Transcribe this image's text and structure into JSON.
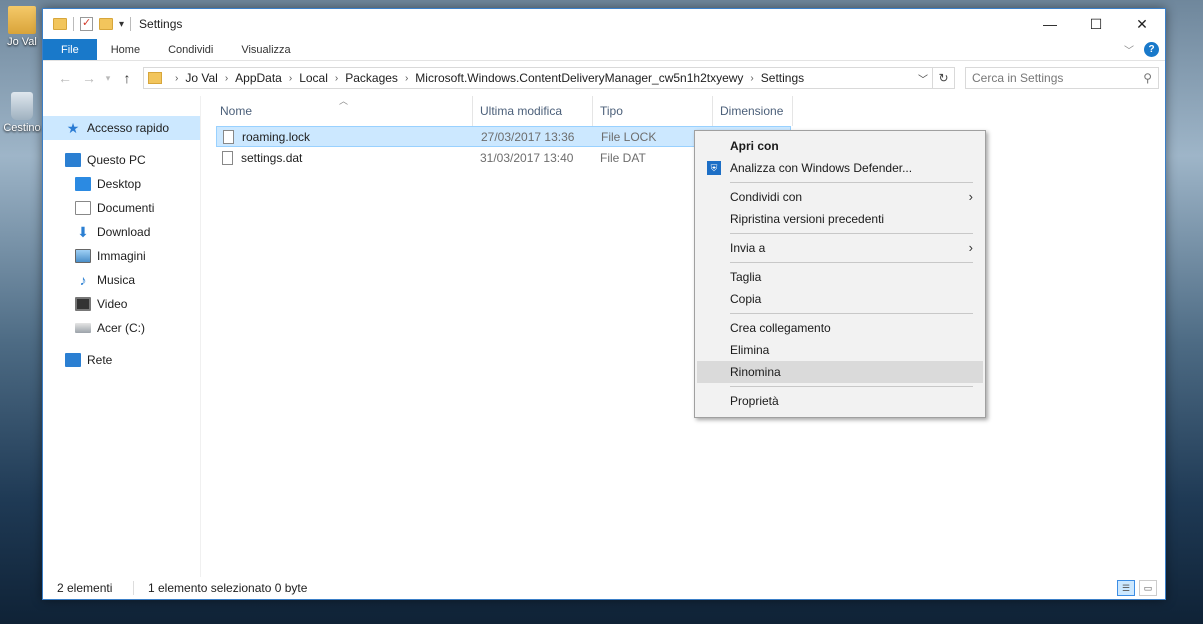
{
  "desktop": {
    "user_label": "Jo Val",
    "bin_label": "Cestino"
  },
  "window": {
    "title": "Settings",
    "controls": {
      "minimize": "—",
      "maximize": "☐",
      "close": "✕"
    }
  },
  "ribbon": {
    "tabs": [
      "File",
      "Home",
      "Condividi",
      "Visualizza"
    ]
  },
  "address": {
    "path": [
      "Jo Val",
      "AppData",
      "Local",
      "Packages",
      "Microsoft.Windows.ContentDeliveryManager_cw5n1h2txyewy",
      "Settings"
    ]
  },
  "search": {
    "placeholder": "Cerca in Settings"
  },
  "sidebar": {
    "items": [
      {
        "label": "Accesso rapido"
      },
      {
        "label": "Questo PC"
      },
      {
        "label": "Desktop"
      },
      {
        "label": "Documenti"
      },
      {
        "label": "Download"
      },
      {
        "label": "Immagini"
      },
      {
        "label": "Musica"
      },
      {
        "label": "Video"
      },
      {
        "label": "Acer (C:)"
      },
      {
        "label": "Rete"
      }
    ]
  },
  "columns": {
    "name": "Nome",
    "date": "Ultima modifica",
    "type": "Tipo",
    "size": "Dimensione"
  },
  "files": [
    {
      "name": "roaming.lock",
      "date": "27/03/2017 13:36",
      "type": "File LOCK"
    },
    {
      "name": "settings.dat",
      "date": "31/03/2017 13:40",
      "type": "File DAT"
    }
  ],
  "status": {
    "count": "2 elementi",
    "selection": "1 elemento selezionato  0 byte"
  },
  "context_menu": {
    "items": [
      "Apri con",
      "Analizza con Windows Defender...",
      "Condividi con",
      "Ripristina versioni precedenti",
      "Invia a",
      "Taglia",
      "Copia",
      "Crea collegamento",
      "Elimina",
      "Rinomina",
      "Proprietà"
    ]
  }
}
